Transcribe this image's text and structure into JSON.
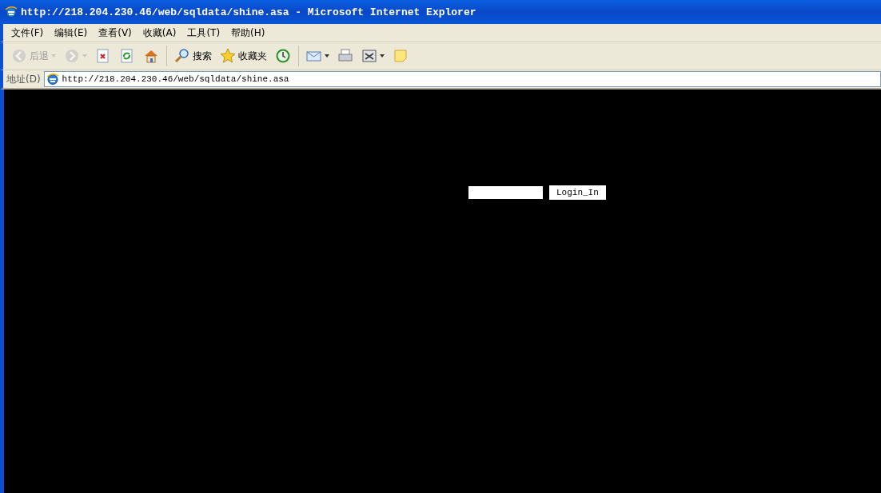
{
  "window": {
    "title": "http://218.204.230.46/web/sqldata/shine.asa - Microsoft Internet Explorer"
  },
  "menu": [
    "文件(F)",
    "编辑(E)",
    "查看(V)",
    "收藏(A)",
    "工具(T)",
    "帮助(H)"
  ],
  "toolbar": [
    {
      "kind": "back",
      "label": "后退",
      "disabled": true,
      "dropdown": true
    },
    {
      "kind": "forward",
      "disabled": true,
      "dropdown": true
    },
    {
      "kind": "stop",
      "disabled": false,
      "dropdown": false
    },
    {
      "kind": "refresh",
      "disabled": false,
      "dropdown": false
    },
    {
      "kind": "home",
      "disabled": false,
      "dropdown": false,
      "separator_after": true
    },
    {
      "kind": "search",
      "label": "搜索",
      "disabled": false,
      "dropdown": false
    },
    {
      "kind": "favorites",
      "label": "收藏夹",
      "disabled": false,
      "dropdown": false
    },
    {
      "kind": "history",
      "disabled": false,
      "dropdown": false,
      "separator_after": true
    },
    {
      "kind": "mail",
      "disabled": false,
      "dropdown": true
    },
    {
      "kind": "print",
      "disabled": false,
      "dropdown": false
    },
    {
      "kind": "edit",
      "disabled": false,
      "dropdown": true
    },
    {
      "kind": "note",
      "disabled": false,
      "dropdown": false
    }
  ],
  "address": {
    "label": "地址(D)",
    "value": "http://218.204.230.46/web/sqldata/shine.asa"
  },
  "login": {
    "button": "Login_In"
  }
}
